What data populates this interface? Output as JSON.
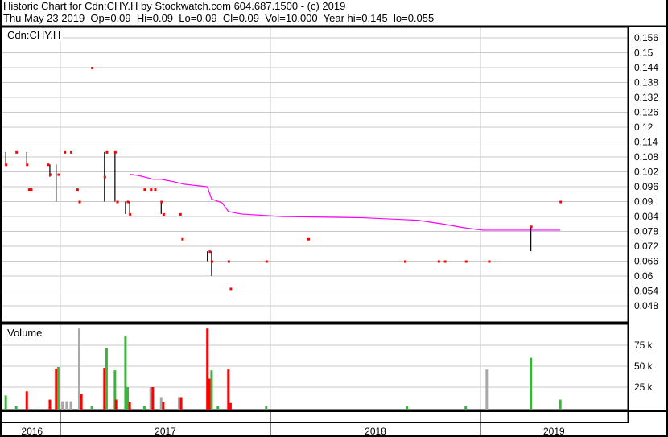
{
  "header": {
    "title": "Historic Chart for Cdn:CHY.H by Stockwatch.com 604.687.1500 - (c) 2019",
    "quote": "Thu May 23 2019  Op=0.09  Hi=0.09  Lo=0.09  Cl=0.09  Vol=10,000  Year hi=0.145  lo=0.055"
  },
  "chart_data": [
    {
      "type": "scatter",
      "title": "Cdn:CHY.H",
      "ylim": [
        0.042,
        0.162
      ],
      "yticks": [
        0.156,
        0.15,
        0.144,
        0.138,
        0.132,
        0.126,
        0.12,
        0.114,
        0.108,
        0.102,
        0.096,
        0.09,
        0.084,
        0.078,
        0.072,
        0.066,
        0.06,
        0.054,
        0.048
      ],
      "xlim": [
        2016.73,
        2019.7
      ],
      "xticks": [
        {
          "label": "2016",
          "from": 2016.73,
          "to": 2017.0
        },
        {
          "label": "2017",
          "from": 2017.0,
          "to": 2018.0
        },
        {
          "label": "2018",
          "from": 2018.0,
          "to": 2019.0
        },
        {
          "label": "2019",
          "from": 2019.0,
          "to": 2019.7
        }
      ],
      "price_points": [
        [
          2016.74,
          0.105
        ],
        [
          2016.79,
          0.11
        ],
        [
          2016.84,
          0.105
        ],
        [
          2016.85,
          0.095
        ],
        [
          2016.86,
          0.095
        ],
        [
          2016.94,
          0.105
        ],
        [
          2016.95,
          0.101
        ],
        [
          2016.99,
          0.101
        ],
        [
          2017.02,
          0.11
        ],
        [
          2017.05,
          0.11
        ],
        [
          2017.08,
          0.095
        ],
        [
          2017.09,
          0.09
        ],
        [
          2017.15,
          0.144
        ],
        [
          2017.21,
          0.1
        ],
        [
          2017.22,
          0.11
        ],
        [
          2017.26,
          0.11
        ],
        [
          2017.27,
          0.09
        ],
        [
          2017.32,
          0.09
        ],
        [
          2017.33,
          0.085
        ],
        [
          2017.4,
          0.095
        ],
        [
          2017.43,
          0.095
        ],
        [
          2017.45,
          0.095
        ],
        [
          2017.48,
          0.09
        ],
        [
          2017.49,
          0.085
        ],
        [
          2017.57,
          0.085
        ],
        [
          2017.58,
          0.075
        ],
        [
          2017.71,
          0.07
        ],
        [
          2017.72,
          0.066
        ],
        [
          2017.8,
          0.066
        ],
        [
          2017.81,
          0.055
        ],
        [
          2017.98,
          0.066
        ],
        [
          2018.18,
          0.075
        ],
        [
          2018.64,
          0.066
        ],
        [
          2018.8,
          0.066
        ],
        [
          2018.83,
          0.066
        ],
        [
          2018.93,
          0.066
        ],
        [
          2019.04,
          0.066
        ],
        [
          2019.24,
          0.08
        ],
        [
          2019.38,
          0.09
        ]
      ],
      "price_bars": [
        [
          2016.74,
          0.11,
          0.105
        ],
        [
          2016.84,
          0.11,
          0.105
        ],
        [
          2016.95,
          0.105,
          0.1
        ],
        [
          2016.98,
          0.105,
          0.09
        ],
        [
          2017.21,
          0.11,
          0.09
        ],
        [
          2017.26,
          0.11,
          0.09
        ],
        [
          2017.31,
          0.09,
          0.085
        ],
        [
          2017.33,
          0.09,
          0.085
        ],
        [
          2017.48,
          0.09,
          0.085
        ],
        [
          2017.7,
          0.07,
          0.066
        ],
        [
          2017.72,
          0.07,
          0.06
        ],
        [
          2019.24,
          0.08,
          0.07
        ]
      ],
      "moving_average": [
        [
          2017.33,
          0.101
        ],
        [
          2017.37,
          0.1005
        ],
        [
          2017.42,
          0.0995
        ],
        [
          2017.44,
          0.099
        ],
        [
          2017.48,
          0.099
        ],
        [
          2017.54,
          0.098
        ],
        [
          2017.59,
          0.097
        ],
        [
          2017.7,
          0.096
        ],
        [
          2017.72,
          0.091
        ],
        [
          2017.77,
          0.0895
        ],
        [
          2017.8,
          0.086
        ],
        [
          2017.86,
          0.085
        ],
        [
          2018.05,
          0.084
        ],
        [
          2018.44,
          0.0835
        ],
        [
          2018.7,
          0.0825
        ],
        [
          2018.82,
          0.081
        ],
        [
          2018.92,
          0.0795
        ],
        [
          2019.01,
          0.0785
        ],
        [
          2019.38,
          0.0785
        ]
      ]
    },
    {
      "type": "bar",
      "title": "Volume",
      "ylim": [
        0,
        100
      ],
      "yticks": [
        {
          "v": 75,
          "label": "75 k"
        },
        {
          "v": 50,
          "label": "50 k"
        },
        {
          "v": 25,
          "label": "25 k"
        }
      ],
      "bars": [
        [
          2016.74,
          15,
          "up"
        ],
        [
          2016.79,
          2,
          "up"
        ],
        [
          2016.84,
          20,
          "down"
        ],
        [
          2016.95,
          10,
          "down"
        ],
        [
          2016.98,
          47,
          "down"
        ],
        [
          2016.99,
          49,
          "up"
        ],
        [
          2017.01,
          8,
          "flat"
        ],
        [
          2017.03,
          8,
          "flat"
        ],
        [
          2017.05,
          8,
          "flat"
        ],
        [
          2017.09,
          95,
          "flat"
        ],
        [
          2017.1,
          17,
          "down"
        ],
        [
          2017.15,
          2,
          "up"
        ],
        [
          2017.21,
          48,
          "down"
        ],
        [
          2017.22,
          72,
          "up"
        ],
        [
          2017.26,
          45,
          "up"
        ],
        [
          2017.265,
          10,
          "down"
        ],
        [
          2017.31,
          86,
          "up"
        ],
        [
          2017.32,
          25,
          "up"
        ],
        [
          2017.33,
          7,
          "down"
        ],
        [
          2017.4,
          2,
          "up"
        ],
        [
          2017.43,
          25,
          "flat"
        ],
        [
          2017.44,
          25,
          "down"
        ],
        [
          2017.48,
          13,
          "flat"
        ],
        [
          2017.49,
          7,
          "down"
        ],
        [
          2017.565,
          13,
          "flat"
        ],
        [
          2017.575,
          13,
          "down"
        ],
        [
          2017.7,
          95,
          "down"
        ],
        [
          2017.71,
          35,
          "down"
        ],
        [
          2017.72,
          45,
          "up"
        ],
        [
          2017.75,
          2,
          "up"
        ],
        [
          2017.8,
          46,
          "down"
        ],
        [
          2017.81,
          6,
          "down"
        ],
        [
          2017.98,
          2,
          "up"
        ],
        [
          2018.65,
          2,
          "up"
        ],
        [
          2018.93,
          2,
          "up"
        ],
        [
          2019.03,
          46,
          "flat"
        ],
        [
          2019.24,
          60,
          "up"
        ],
        [
          2019.38,
          10,
          "up"
        ]
      ]
    }
  ],
  "colors": {
    "up": "#3cb43c",
    "down": "#ff0000",
    "flat": "#a8a8a8",
    "ma": "#ff00ff",
    "grid": "#c8c8c8"
  }
}
